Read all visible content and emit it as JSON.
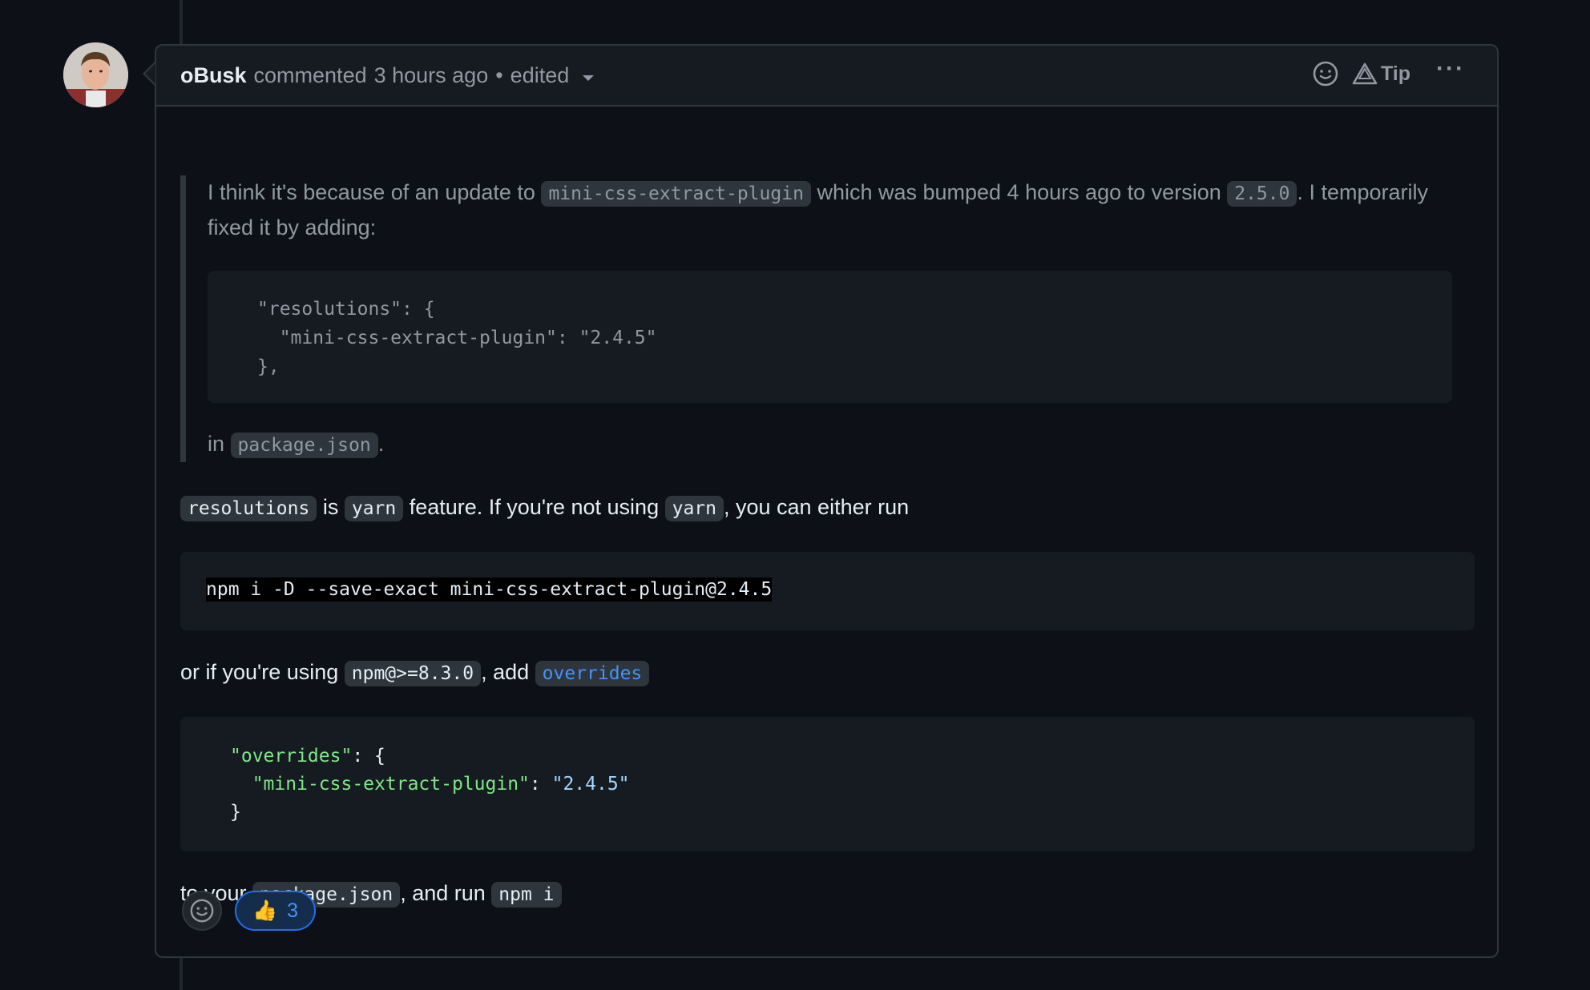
{
  "comment": {
    "author": "oBusk",
    "action": "commented",
    "time": "3 hours ago",
    "separator": "•",
    "edited": "edited",
    "tip_label": "Tip",
    "more_label": "···"
  },
  "quote": {
    "p1_a": "I think it's because of an update to ",
    "p1_code1": "mini-css-extract-plugin",
    "p1_b": " which was bumped 4 hours ago to version ",
    "p1_code2": "2.5.0",
    "p1_c": ". I temporarily fixed it by adding:",
    "code": "\"resolutions\": {\n  \"mini-css-extract-plugin\": \"2.4.5\"\n},",
    "p2_a": "in ",
    "p2_code": "package.json",
    "p2_b": "."
  },
  "para1": {
    "code1": "resolutions",
    "t1": " is ",
    "code2": "yarn",
    "t2": " feature. If you're not using ",
    "code3": "yarn",
    "t3": ", you can either run"
  },
  "command": "npm i -D --save-exact mini-css-extract-plugin@2.4.5",
  "para2": {
    "t1": "or if you're using ",
    "code1": "npm@>=8.3.0",
    "t2": ", add ",
    "link": "overrides"
  },
  "json_block": {
    "l1_key": "\"overrides\"",
    "l1_rest": ": {",
    "l2_key": "\"mini-css-extract-plugin\"",
    "l2_colon": ": ",
    "l2_val": "\"2.4.5\"",
    "l3": "}"
  },
  "para3": {
    "t1": "to your ",
    "code1": "package.json",
    "t2": ", and run ",
    "code2": "npm i"
  },
  "reactions": {
    "thumbs_emoji": "👍",
    "thumbs_count": "3"
  },
  "colors": {
    "background": "#0d1117",
    "header_bg": "#161b22",
    "border": "#30363d",
    "link": "#4493f8",
    "json_key": "#7ee787",
    "json_string": "#a5d6ff"
  }
}
